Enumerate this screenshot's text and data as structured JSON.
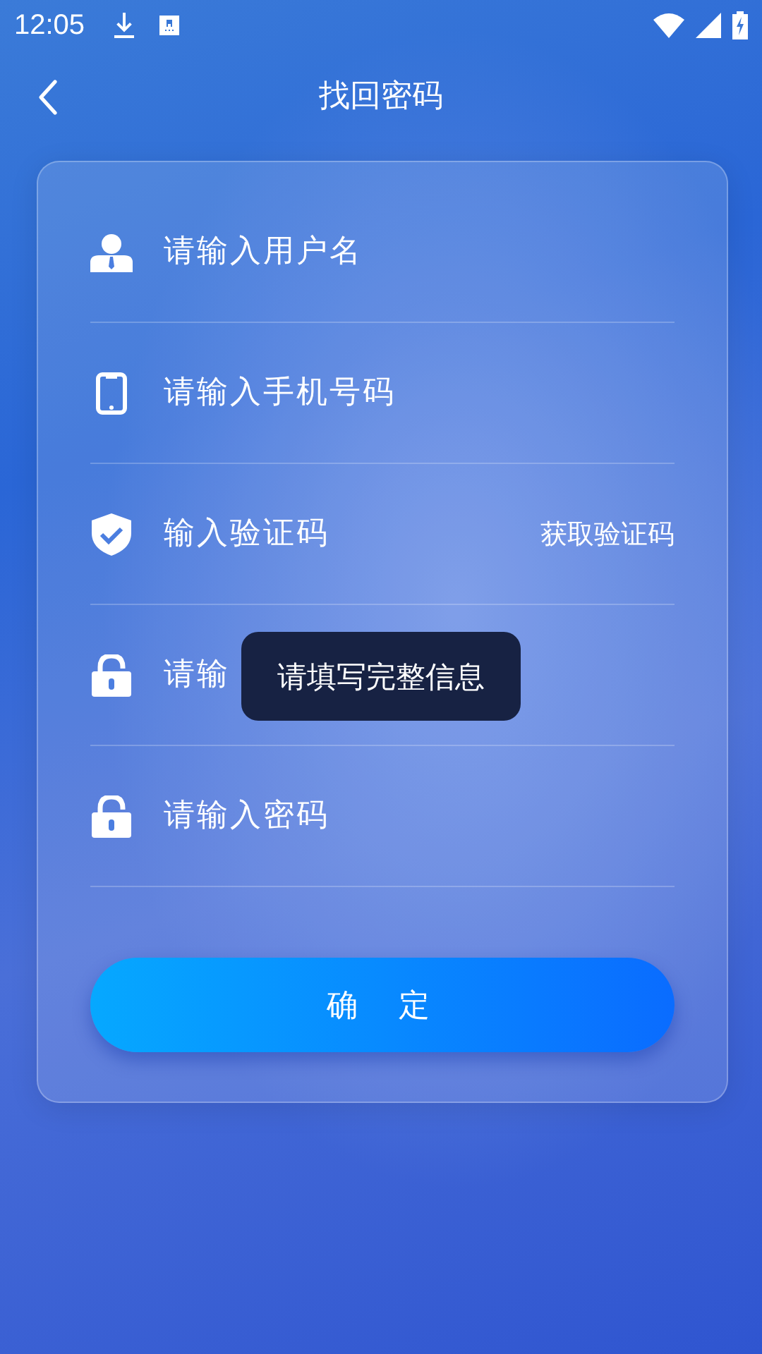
{
  "status_bar": {
    "time": "12:05"
  },
  "header": {
    "title": "找回密码"
  },
  "fields": [
    {
      "kind": "user",
      "placeholder": "请输入用户名"
    },
    {
      "kind": "phone",
      "placeholder": "请输入手机号码"
    },
    {
      "kind": "shield",
      "placeholder": "输入验证码",
      "action": "获取验证码"
    },
    {
      "kind": "lock",
      "placeholder": "请输"
    },
    {
      "kind": "lock",
      "placeholder": "请输入密码"
    }
  ],
  "submit": {
    "label": "确定"
  },
  "toast": {
    "text": "请填写完整信息"
  }
}
